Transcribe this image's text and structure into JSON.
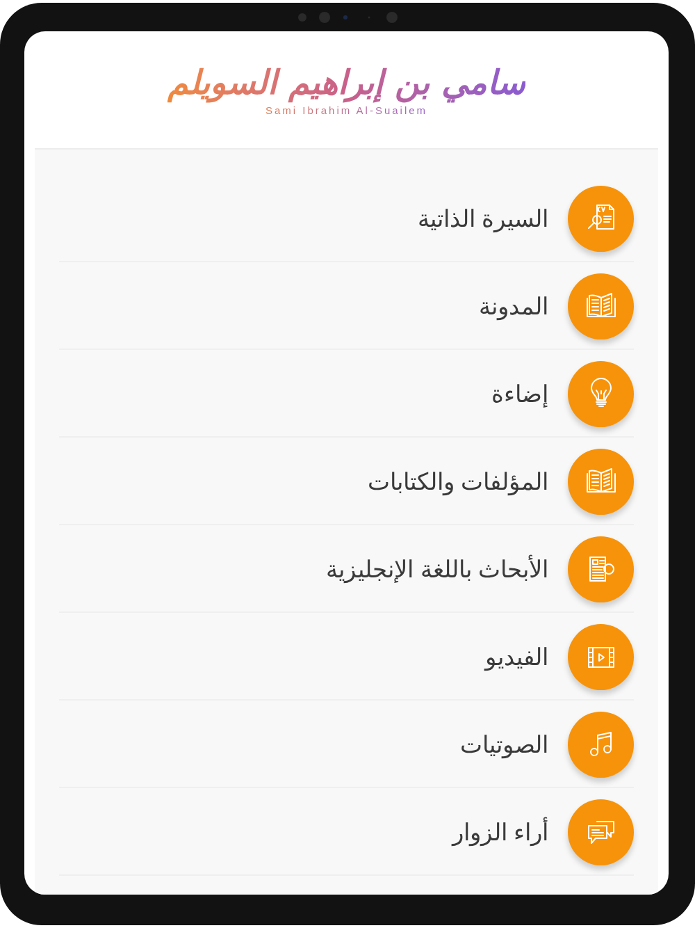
{
  "logo": {
    "calligraphy": "سامي بن إبراهيم السويلم",
    "latin": "Sami Ibrahim Al-Suailem"
  },
  "menu": [
    {
      "label": "السيرة الذاتية",
      "kind": "cv"
    },
    {
      "label": "المدونة",
      "kind": "book"
    },
    {
      "label": "إضاءة",
      "kind": "bulb"
    },
    {
      "label": "المؤلفات والكتابات",
      "kind": "book"
    },
    {
      "label": "الأبحاث باللغة الإنجليزية",
      "kind": "research"
    },
    {
      "label": "الفيديو",
      "kind": "video"
    },
    {
      "label": "الصوتيات",
      "kind": "music"
    },
    {
      "label": "أراء الزوار",
      "kind": "chat"
    }
  ]
}
